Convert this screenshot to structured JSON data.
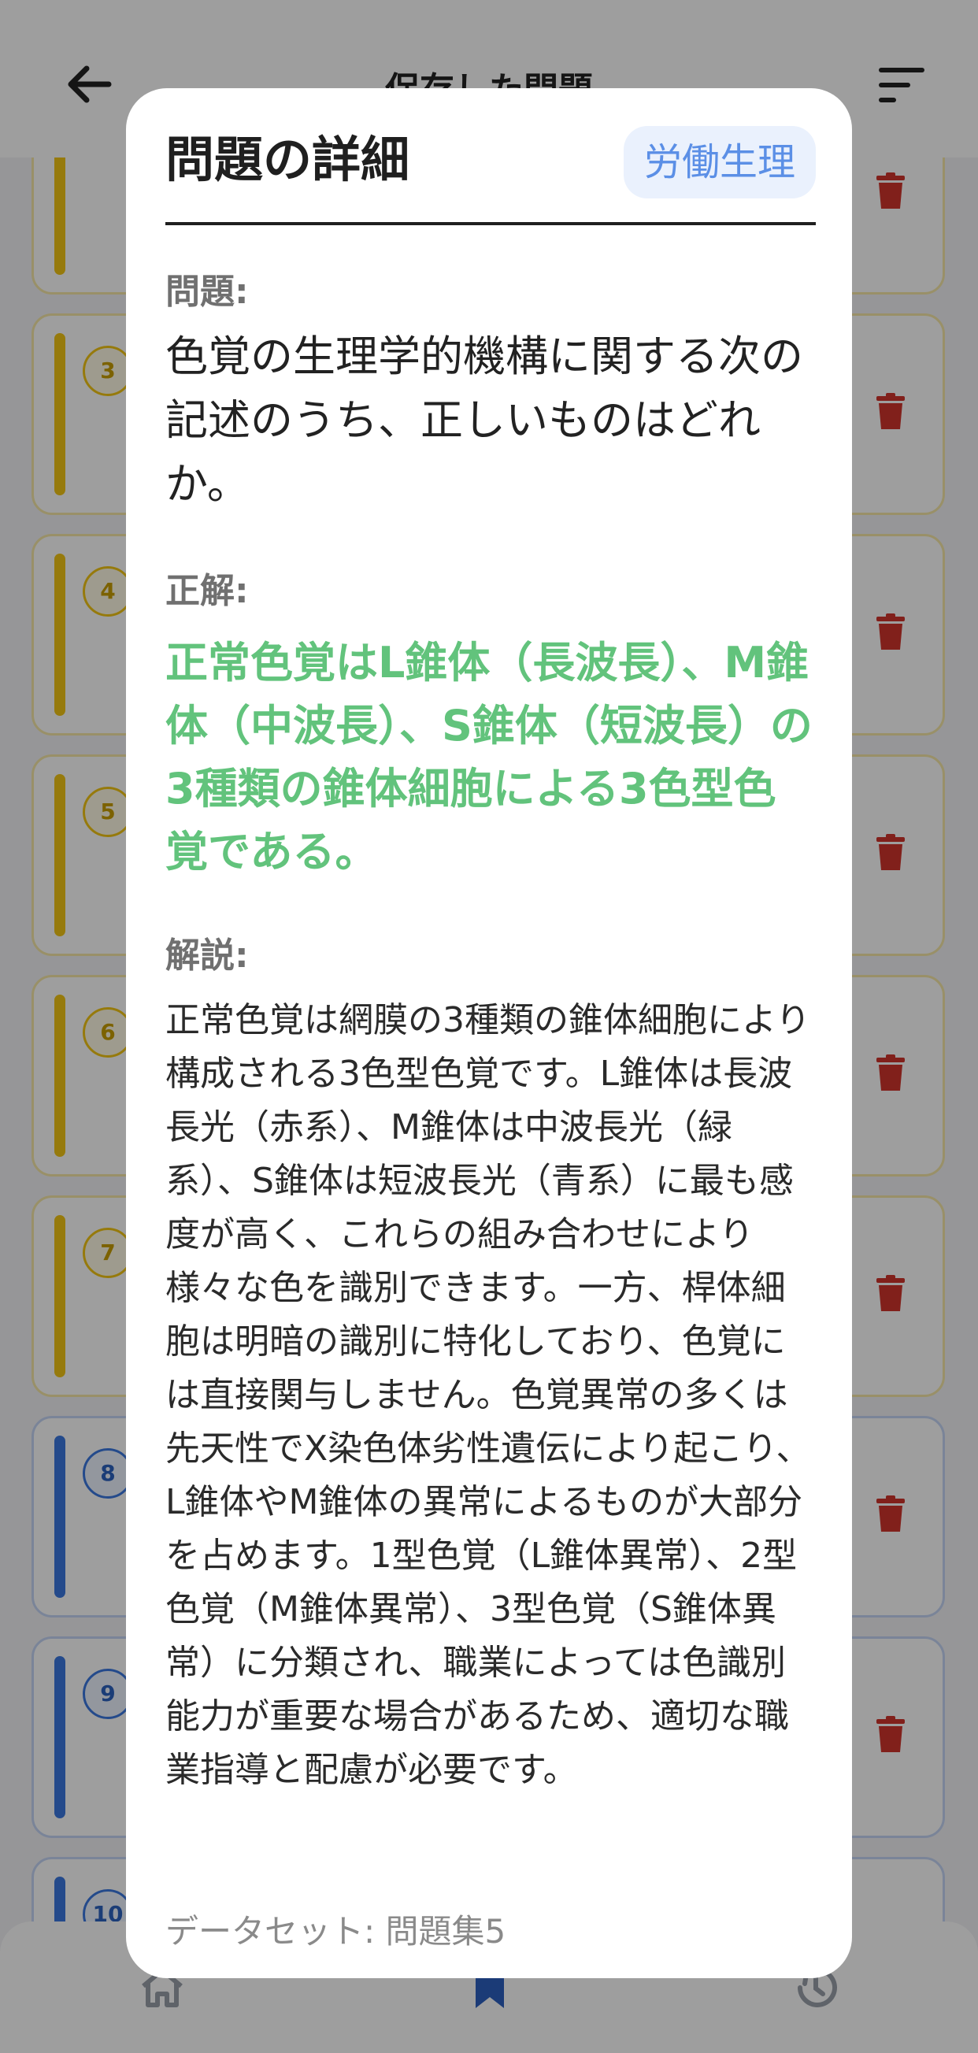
{
  "header": {
    "title": "保存した問題"
  },
  "list": {
    "cards": [
      {
        "number": "",
        "color": "yellow"
      },
      {
        "number": "3",
        "color": "yellow"
      },
      {
        "number": "4",
        "color": "yellow"
      },
      {
        "number": "5",
        "color": "yellow"
      },
      {
        "number": "6",
        "color": "yellow"
      },
      {
        "number": "7",
        "color": "yellow"
      },
      {
        "number": "8",
        "color": "blue"
      },
      {
        "number": "9",
        "color": "blue"
      },
      {
        "number": "10",
        "color": "blue"
      }
    ]
  },
  "modal": {
    "title": "問題の詳細",
    "category": "労働生理",
    "question_label": "問題:",
    "question": "色覚の生理学的機構に関する次の記述のうち、正しいものはどれか。",
    "answer_label": "正解:",
    "answer": "正常色覚はL錐体（長波長）、M錐体（中波長）、S錐体（短波長）の3種類の錐体細胞による3色型色覚である。",
    "explanation_label": "解説:",
    "explanation": "正常色覚は網膜の3種類の錐体細胞により構成される3色型色覚です。L錐体は長波長光（赤系）、M錐体は中波長光（緑系）、S錐体は短波長光（青系）に最も感度が高く、これらの組み合わせにより様々な色を識別できます。一方、桿体細胞は明暗の識別に特化しており、色覚には直接関与しません。色覚異常の多くは先天性でX染色体劣性遺伝により起こり、L錐体やM錐体の異常によるものが大部分を占めます。1型色覚（L錐体異常）、2型色覚（M錐体異常）、3型色覚（S錐体異常）に分類され、職業によっては色識別能力が重要な場合があるため、適切な職業指導と配慮が必要です。",
    "dataset": "データセット: 問題集5"
  },
  "colors": {
    "accent_blue": "#3a78e0",
    "accent_yellow": "#f2c614",
    "answer_green": "#62c37c",
    "trash_red": "#d0342c"
  },
  "icons": [
    "back-arrow-icon",
    "sort-icon",
    "trash-icon",
    "home-icon",
    "bookmark-icon",
    "history-icon"
  ]
}
